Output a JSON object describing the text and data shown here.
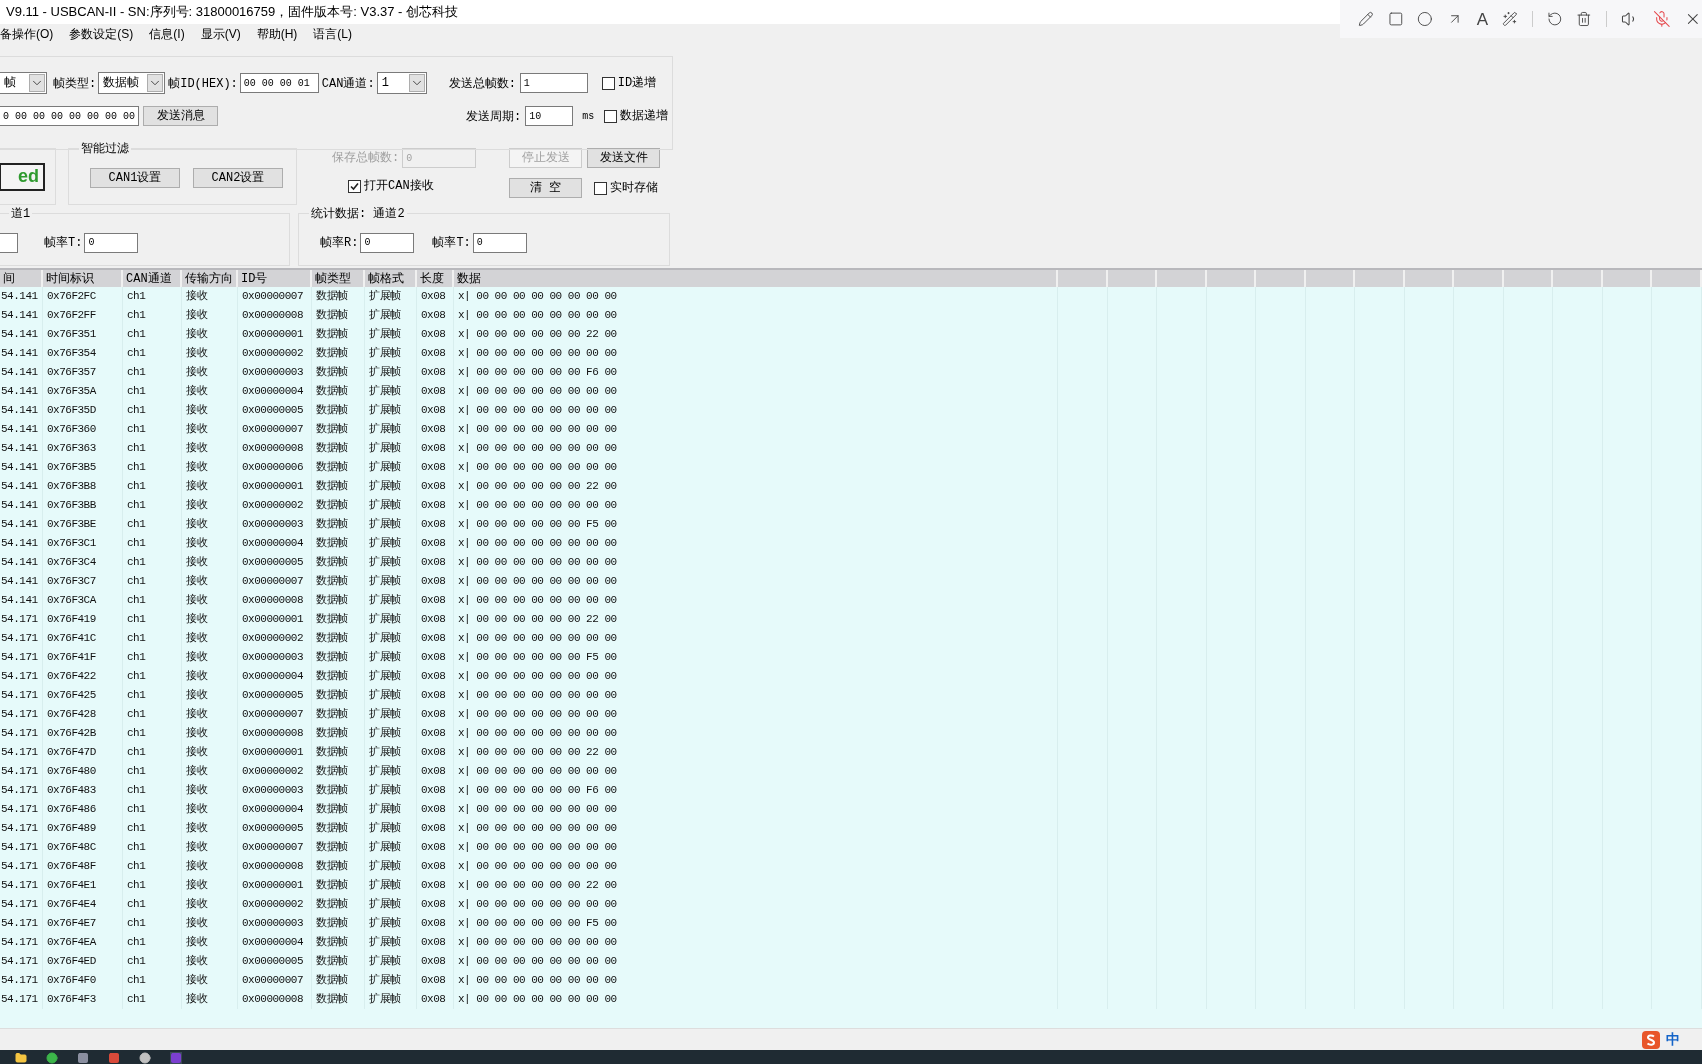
{
  "title_bar": {
    "title": "V9.11 - USBCAN-II - SN:序列号: 31800016759，固件版本号: V3.37 - 创芯科技"
  },
  "annotation_toolbar": {
    "text_tool": "A",
    "mic_muted": true
  },
  "menu": [
    "备操作(O)",
    "参数设定(S)",
    "信息(I)",
    "显示(V)",
    "帮助(H)",
    "语言(L)"
  ],
  "send": {
    "frame_format_value": "帧",
    "frame_type_label": "帧类型:",
    "frame_type_value": "数据帧",
    "frame_id_label": "帧ID(HEX):",
    "frame_id_value": "00 00 00 01",
    "can_channel_label": "CAN通道:",
    "can_channel_value": "1",
    "total_frames_label": "发送总帧数:",
    "total_frames_value": "1",
    "data_value": "0 00 00 00 00 00 00 00",
    "send_button": "发送消息",
    "period_label": "发送周期:",
    "period_value": "10",
    "period_unit": "ms",
    "checkboxes": [
      {
        "label": "ID递增",
        "checked": false
      },
      {
        "label": "数据递增",
        "checked": false
      }
    ]
  },
  "device_button": {
    "label": "ed"
  },
  "smart_filter": {
    "title": "智能过滤",
    "buttons": [
      "CAN1设置",
      "CAN2设置"
    ]
  },
  "receive": {
    "saved_frames_label": "保存总帧数:",
    "saved_frames_value": "0",
    "disabled": true,
    "open_receive": {
      "label": "打开CAN接收",
      "checked": true
    }
  },
  "actions": [
    {
      "label": "停止发送",
      "disabled": true
    },
    {
      "label": "发送文件",
      "disabled": false
    },
    {
      "label": "清 空",
      "disabled": false
    }
  ],
  "realtime_save": {
    "label": "实时存储",
    "checked": false
  },
  "stats": [
    {
      "title": "道1",
      "fields": [
        {
          "label": "帧率T:",
          "value": "0"
        }
      ]
    },
    {
      "title": "统计数据: 通道2",
      "fields": [
        {
          "label": "帧率R:",
          "value": "0"
        },
        {
          "label": "帧率T:",
          "value": "0"
        }
      ]
    }
  ],
  "table": {
    "columns": [
      "间",
      "时间标识",
      "CAN通道",
      "传输方向",
      "ID号",
      "帧类型",
      "帧格式",
      "长度",
      "数据"
    ],
    "rows": [
      [
        "54.141",
        "0x76F2FC",
        "ch1",
        "接收",
        "0x00000007",
        "数据帧",
        "扩展帧",
        "0x08",
        "x| 00 00 00 00 00 00 00 00"
      ],
      [
        "54.141",
        "0x76F2FF",
        "ch1",
        "接收",
        "0x00000008",
        "数据帧",
        "扩展帧",
        "0x08",
        "x| 00 00 00 00 00 00 00 00"
      ],
      [
        "54.141",
        "0x76F351",
        "ch1",
        "接收",
        "0x00000001",
        "数据帧",
        "扩展帧",
        "0x08",
        "x| 00 00 00 00 00 00 22 00"
      ],
      [
        "54.141",
        "0x76F354",
        "ch1",
        "接收",
        "0x00000002",
        "数据帧",
        "扩展帧",
        "0x08",
        "x| 00 00 00 00 00 00 00 00"
      ],
      [
        "54.141",
        "0x76F357",
        "ch1",
        "接收",
        "0x00000003",
        "数据帧",
        "扩展帧",
        "0x08",
        "x| 00 00 00 00 00 00 F6 00"
      ],
      [
        "54.141",
        "0x76F35A",
        "ch1",
        "接收",
        "0x00000004",
        "数据帧",
        "扩展帧",
        "0x08",
        "x| 00 00 00 00 00 00 00 00"
      ],
      [
        "54.141",
        "0x76F35D",
        "ch1",
        "接收",
        "0x00000005",
        "数据帧",
        "扩展帧",
        "0x08",
        "x| 00 00 00 00 00 00 00 00"
      ],
      [
        "54.141",
        "0x76F360",
        "ch1",
        "接收",
        "0x00000007",
        "数据帧",
        "扩展帧",
        "0x08",
        "x| 00 00 00 00 00 00 00 00"
      ],
      [
        "54.141",
        "0x76F363",
        "ch1",
        "接收",
        "0x00000008",
        "数据帧",
        "扩展帧",
        "0x08",
        "x| 00 00 00 00 00 00 00 00"
      ],
      [
        "54.141",
        "0x76F3B5",
        "ch1",
        "接收",
        "0x00000006",
        "数据帧",
        "扩展帧",
        "0x08",
        "x| 00 00 00 00 00 00 00 00"
      ],
      [
        "54.141",
        "0x76F3B8",
        "ch1",
        "接收",
        "0x00000001",
        "数据帧",
        "扩展帧",
        "0x08",
        "x| 00 00 00 00 00 00 22 00"
      ],
      [
        "54.141",
        "0x76F3BB",
        "ch1",
        "接收",
        "0x00000002",
        "数据帧",
        "扩展帧",
        "0x08",
        "x| 00 00 00 00 00 00 00 00"
      ],
      [
        "54.141",
        "0x76F3BE",
        "ch1",
        "接收",
        "0x00000003",
        "数据帧",
        "扩展帧",
        "0x08",
        "x| 00 00 00 00 00 00 F5 00"
      ],
      [
        "54.141",
        "0x76F3C1",
        "ch1",
        "接收",
        "0x00000004",
        "数据帧",
        "扩展帧",
        "0x08",
        "x| 00 00 00 00 00 00 00 00"
      ],
      [
        "54.141",
        "0x76F3C4",
        "ch1",
        "接收",
        "0x00000005",
        "数据帧",
        "扩展帧",
        "0x08",
        "x| 00 00 00 00 00 00 00 00"
      ],
      [
        "54.141",
        "0x76F3C7",
        "ch1",
        "接收",
        "0x00000007",
        "数据帧",
        "扩展帧",
        "0x08",
        "x| 00 00 00 00 00 00 00 00"
      ],
      [
        "54.141",
        "0x76F3CA",
        "ch1",
        "接收",
        "0x00000008",
        "数据帧",
        "扩展帧",
        "0x08",
        "x| 00 00 00 00 00 00 00 00"
      ],
      [
        "54.171",
        "0x76F419",
        "ch1",
        "接收",
        "0x00000001",
        "数据帧",
        "扩展帧",
        "0x08",
        "x| 00 00 00 00 00 00 22 00"
      ],
      [
        "54.171",
        "0x76F41C",
        "ch1",
        "接收",
        "0x00000002",
        "数据帧",
        "扩展帧",
        "0x08",
        "x| 00 00 00 00 00 00 00 00"
      ],
      [
        "54.171",
        "0x76F41F",
        "ch1",
        "接收",
        "0x00000003",
        "数据帧",
        "扩展帧",
        "0x08",
        "x| 00 00 00 00 00 00 F5 00"
      ],
      [
        "54.171",
        "0x76F422",
        "ch1",
        "接收",
        "0x00000004",
        "数据帧",
        "扩展帧",
        "0x08",
        "x| 00 00 00 00 00 00 00 00"
      ],
      [
        "54.171",
        "0x76F425",
        "ch1",
        "接收",
        "0x00000005",
        "数据帧",
        "扩展帧",
        "0x08",
        "x| 00 00 00 00 00 00 00 00"
      ],
      [
        "54.171",
        "0x76F428",
        "ch1",
        "接收",
        "0x00000007",
        "数据帧",
        "扩展帧",
        "0x08",
        "x| 00 00 00 00 00 00 00 00"
      ],
      [
        "54.171",
        "0x76F42B",
        "ch1",
        "接收",
        "0x00000008",
        "数据帧",
        "扩展帧",
        "0x08",
        "x| 00 00 00 00 00 00 00 00"
      ],
      [
        "54.171",
        "0x76F47D",
        "ch1",
        "接收",
        "0x00000001",
        "数据帧",
        "扩展帧",
        "0x08",
        "x| 00 00 00 00 00 00 22 00"
      ],
      [
        "54.171",
        "0x76F480",
        "ch1",
        "接收",
        "0x00000002",
        "数据帧",
        "扩展帧",
        "0x08",
        "x| 00 00 00 00 00 00 00 00"
      ],
      [
        "54.171",
        "0x76F483",
        "ch1",
        "接收",
        "0x00000003",
        "数据帧",
        "扩展帧",
        "0x08",
        "x| 00 00 00 00 00 00 F6 00"
      ],
      [
        "54.171",
        "0x76F486",
        "ch1",
        "接收",
        "0x00000004",
        "数据帧",
        "扩展帧",
        "0x08",
        "x| 00 00 00 00 00 00 00 00"
      ],
      [
        "54.171",
        "0x76F489",
        "ch1",
        "接收",
        "0x00000005",
        "数据帧",
        "扩展帧",
        "0x08",
        "x| 00 00 00 00 00 00 00 00"
      ],
      [
        "54.171",
        "0x76F48C",
        "ch1",
        "接收",
        "0x00000007",
        "数据帧",
        "扩展帧",
        "0x08",
        "x| 00 00 00 00 00 00 00 00"
      ],
      [
        "54.171",
        "0x76F48F",
        "ch1",
        "接收",
        "0x00000008",
        "数据帧",
        "扩展帧",
        "0x08",
        "x| 00 00 00 00 00 00 00 00"
      ],
      [
        "54.171",
        "0x76F4E1",
        "ch1",
        "接收",
        "0x00000001",
        "数据帧",
        "扩展帧",
        "0x08",
        "x| 00 00 00 00 00 00 22 00"
      ],
      [
        "54.171",
        "0x76F4E4",
        "ch1",
        "接收",
        "0x00000002",
        "数据帧",
        "扩展帧",
        "0x08",
        "x| 00 00 00 00 00 00 00 00"
      ],
      [
        "54.171",
        "0x76F4E7",
        "ch1",
        "接收",
        "0x00000003",
        "数据帧",
        "扩展帧",
        "0x08",
        "x| 00 00 00 00 00 00 F5 00"
      ],
      [
        "54.171",
        "0x76F4EA",
        "ch1",
        "接收",
        "0x00000004",
        "数据帧",
        "扩展帧",
        "0x08",
        "x| 00 00 00 00 00 00 00 00"
      ],
      [
        "54.171",
        "0x76F4ED",
        "ch1",
        "接收",
        "0x00000005",
        "数据帧",
        "扩展帧",
        "0x08",
        "x| 00 00 00 00 00 00 00 00"
      ],
      [
        "54.171",
        "0x76F4F0",
        "ch1",
        "接收",
        "0x00000007",
        "数据帧",
        "扩展帧",
        "0x08",
        "x| 00 00 00 00 00 00 00 00"
      ],
      [
        "54.171",
        "0x76F4F3",
        "ch1",
        "接收",
        "0x00000008",
        "数据帧",
        "扩展帧",
        "0x08",
        "x| 00 00 00 00 00 00 00 00"
      ]
    ]
  },
  "ime": {
    "mode": "中"
  }
}
